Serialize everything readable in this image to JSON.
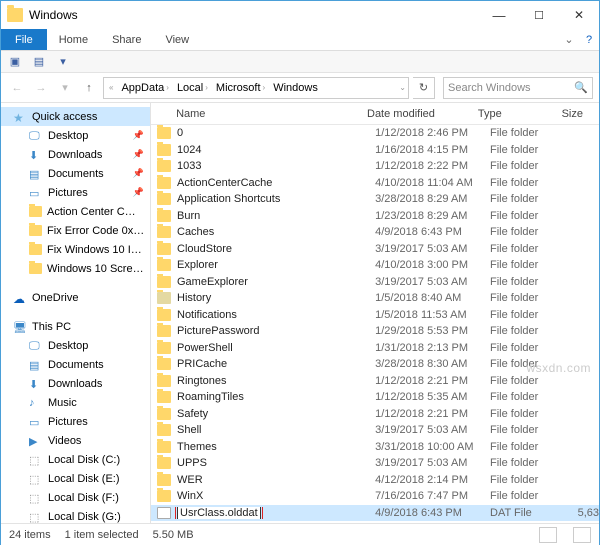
{
  "window": {
    "title": "Windows"
  },
  "ribbon": {
    "file": "File",
    "tabs": [
      "Home",
      "Share",
      "View"
    ]
  },
  "breadcrumbs": [
    "AppData",
    "Local",
    "Microsoft",
    "Windows"
  ],
  "search": {
    "placeholder": "Search Windows"
  },
  "navpane": {
    "quick": "Quick access",
    "pinned": [
      {
        "label": "Desktop",
        "icon": "desktop"
      },
      {
        "label": "Downloads",
        "icon": "dl"
      },
      {
        "label": "Documents",
        "icon": "doc"
      },
      {
        "label": "Pictures",
        "icon": "pic"
      },
      {
        "label": "Action Center C…",
        "icon": "folder"
      },
      {
        "label": "Fix Error Code 0x…",
        "icon": "folder"
      },
      {
        "label": "Fix Windows 10 I…",
        "icon": "folder"
      },
      {
        "label": "Windows 10 Scre…",
        "icon": "folder"
      }
    ],
    "onedrive": "OneDrive",
    "thispc": "This PC",
    "pcitems": [
      {
        "label": "Desktop",
        "icon": "desktop"
      },
      {
        "label": "Documents",
        "icon": "doc"
      },
      {
        "label": "Downloads",
        "icon": "dl"
      },
      {
        "label": "Music",
        "icon": "music"
      },
      {
        "label": "Pictures",
        "icon": "pic"
      },
      {
        "label": "Videos",
        "icon": "vid"
      },
      {
        "label": "Local Disk (C:)",
        "icon": "disk"
      },
      {
        "label": "Local Disk (E:)",
        "icon": "disk"
      },
      {
        "label": "Local Disk (F:)",
        "icon": "disk"
      },
      {
        "label": "Local Disk (G:)",
        "icon": "disk"
      }
    ]
  },
  "columns": {
    "name": "Name",
    "date": "Date modified",
    "type": "Type",
    "size": "Size"
  },
  "files": [
    {
      "name": "0",
      "date": "1/12/2018 2:46 PM",
      "type": "File folder",
      "size": "",
      "icon": "folder"
    },
    {
      "name": "1024",
      "date": "1/16/2018 4:15 PM",
      "type": "File folder",
      "size": "",
      "icon": "folder"
    },
    {
      "name": "1033",
      "date": "1/12/2018 2:22 PM",
      "type": "File folder",
      "size": "",
      "icon": "folder"
    },
    {
      "name": "ActionCenterCache",
      "date": "4/10/2018 11:04 AM",
      "type": "File folder",
      "size": "",
      "icon": "folder"
    },
    {
      "name": "Application Shortcuts",
      "date": "3/28/2018 8:29 AM",
      "type": "File folder",
      "size": "",
      "icon": "folder"
    },
    {
      "name": "Burn",
      "date": "1/23/2018 8:29 AM",
      "type": "File folder",
      "size": "",
      "icon": "folder"
    },
    {
      "name": "Caches",
      "date": "4/9/2018 6:43 PM",
      "type": "File folder",
      "size": "",
      "icon": "folder"
    },
    {
      "name": "CloudStore",
      "date": "3/19/2017 5:03 AM",
      "type": "File folder",
      "size": "",
      "icon": "folder"
    },
    {
      "name": "Explorer",
      "date": "4/10/2018 3:00 PM",
      "type": "File folder",
      "size": "",
      "icon": "folder"
    },
    {
      "name": "GameExplorer",
      "date": "3/19/2017 5:03 AM",
      "type": "File folder",
      "size": "",
      "icon": "folder"
    },
    {
      "name": "History",
      "date": "1/5/2018 8:40 AM",
      "type": "File folder",
      "size": "",
      "icon": "history"
    },
    {
      "name": "Notifications",
      "date": "1/5/2018 11:53 AM",
      "type": "File folder",
      "size": "",
      "icon": "folder"
    },
    {
      "name": "PicturePassword",
      "date": "1/29/2018 5:53 PM",
      "type": "File folder",
      "size": "",
      "icon": "folder"
    },
    {
      "name": "PowerShell",
      "date": "1/31/2018 2:13 PM",
      "type": "File folder",
      "size": "",
      "icon": "folder"
    },
    {
      "name": "PRICache",
      "date": "3/28/2018 8:30 AM",
      "type": "File folder",
      "size": "",
      "icon": "folder"
    },
    {
      "name": "Ringtones",
      "date": "1/12/2018 2:21 PM",
      "type": "File folder",
      "size": "",
      "icon": "folder"
    },
    {
      "name": "RoamingTiles",
      "date": "1/12/2018 5:35 AM",
      "type": "File folder",
      "size": "",
      "icon": "folder"
    },
    {
      "name": "Safety",
      "date": "1/12/2018 2:21 PM",
      "type": "File folder",
      "size": "",
      "icon": "folder"
    },
    {
      "name": "Shell",
      "date": "3/19/2017 5:03 AM",
      "type": "File folder",
      "size": "",
      "icon": "folder"
    },
    {
      "name": "Themes",
      "date": "3/31/2018 10:00 AM",
      "type": "File folder",
      "size": "",
      "icon": "folder"
    },
    {
      "name": "UPPS",
      "date": "3/19/2017 5:03 AM",
      "type": "File folder",
      "size": "",
      "icon": "folder"
    },
    {
      "name": "WER",
      "date": "4/12/2018 2:14 PM",
      "type": "File folder",
      "size": "",
      "icon": "folder"
    },
    {
      "name": "WinX",
      "date": "7/16/2016 7:47 PM",
      "type": "File folder",
      "size": "",
      "icon": "folder"
    },
    {
      "name": "UsrClass.olddat",
      "date": "4/9/2018 6:43 PM",
      "type": "DAT File",
      "size": "5,63",
      "icon": "dat",
      "selected": true,
      "rename": true
    }
  ],
  "status": {
    "count": "24 items",
    "sel": "1 item selected",
    "size": "5.50 MB"
  },
  "watermark": "wsxdn.com"
}
